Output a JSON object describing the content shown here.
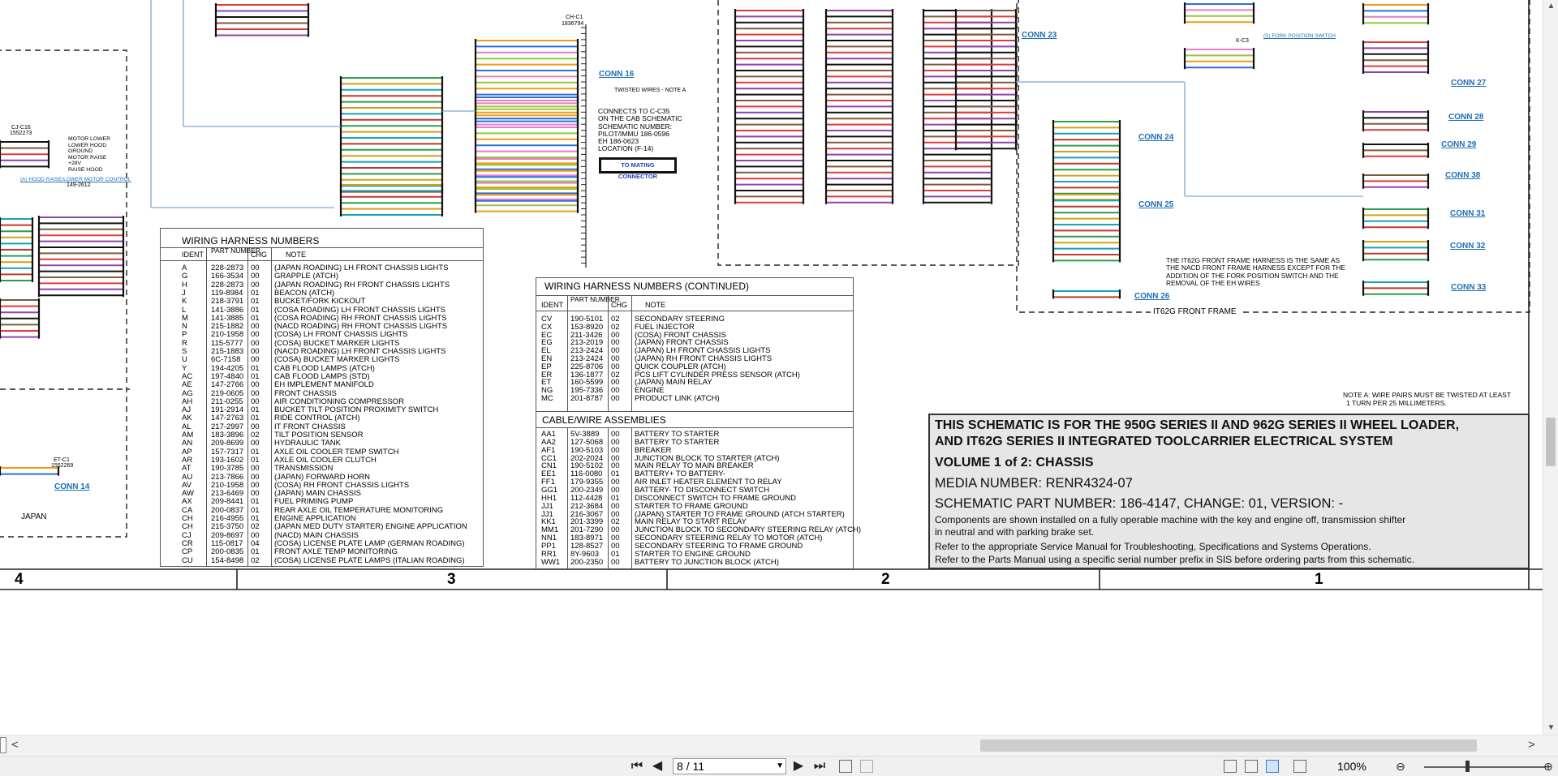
{
  "schematic": {
    "connectors": {
      "conn16": "CONN 16",
      "conn23": "CONN 23",
      "conn24": "CONN 24",
      "conn25": "CONN 25",
      "conn26": "CONN 26",
      "conn27": "CONN 27",
      "conn28": "CONN 28",
      "conn29": "CONN 29",
      "conn38": "CONN 38",
      "conn31": "CONN 31",
      "conn32": "CONN 32",
      "conn33": "CONN 33",
      "conn14": "CONN 14"
    },
    "ch_c1": "CH-C1",
    "ch_c1_part": "1836794",
    "twisted_note": "TWISTED WIRES - NOTE A",
    "connects_note": [
      "CONNECTS TO C-C35",
      "ON THE CAB SCHEMATIC",
      "SCHEMATIC NUMBER:",
      "PILOT/IMMU 186-0596",
      "EH      186-0623",
      "LOCATION (F-14)"
    ],
    "mating_button": "TO MATING CONNECTOR",
    "hood_link": "(A) HOOD RAISE/LOWER MOTOR CONTROL",
    "hood_part": "149-2612",
    "japan_label": "JAPAN",
    "fork_switch": "(S) FORK POSITION SWITCH",
    "kc3": "K-C3",
    "frame_label": "IT62G FRONT FRAME",
    "frame_note": [
      "THE IT62G FRONT FRAME HARNESS IS THE SAME AS",
      "THE NACD FRONT FRAME HARNESS EXCEPT FOR THE",
      "ADDITION OF THE FORK POSITION SWITCH AND THE",
      "REMOVAL OF THE EH WIRES"
    ],
    "note_a": [
      "NOTE A: WIRE PAIRS MUST BE TWISTED AT LEAST",
      "1 TURN PER 25 MILLIMETERS."
    ],
    "motor_labels": [
      "MOTOR LOWER",
      "LOWER HOOD",
      "GROUND",
      "MOTOR RAISE",
      "+28V",
      "RAISE HOOD"
    ],
    "cjc16": "CJ-C16",
    "cjc16_part": "1552273",
    "etc1": "ET-C1",
    "etc1_part": "1552269",
    "zones": [
      "4",
      "3",
      "2",
      "1"
    ]
  },
  "harness_table": {
    "title": "WIRING HARNESS NUMBERS",
    "headers": {
      "ident": "IDENT",
      "part": "PART NUMBER",
      "chg": "CHG",
      "note": "NOTE"
    },
    "rows": [
      [
        "A",
        "228-2873",
        "00",
        "(JAPAN ROADING) LH FRONT CHASSIS LIGHTS"
      ],
      [
        "G",
        "166-3534",
        "00",
        "GRAPPLE (ATCH)"
      ],
      [
        "H",
        "228-2873",
        "00",
        "(JAPAN ROADING) RH FRONT CHASSIS LIGHTS"
      ],
      [
        "J",
        "119-8984",
        "01",
        "BEACON (ATCH)"
      ],
      [
        "K",
        "218-3791",
        "01",
        "BUCKET/FORK KICKOUT"
      ],
      [
        "L",
        "141-3886",
        "01",
        "(COSA ROADING) LH FRONT CHASSIS LIGHTS"
      ],
      [
        "M",
        "141-3885",
        "01",
        "(COSA ROADING) RH FRONT CHASSIS LIGHTS"
      ],
      [
        "N",
        "215-1882",
        "00",
        "(NACD ROADING) RH FRONT CHASSIS LIGHTS"
      ],
      [
        "P",
        "210-1958",
        "00",
        "(COSA) LH FRONT CHASSIS LIGHTS"
      ],
      [
        "R",
        "115-5777",
        "00",
        "(COSA) BUCKET MARKER LIGHTS"
      ],
      [
        "S",
        "215-1883",
        "00",
        "(NACD ROADING) LH FRONT CHASSIS LIGHTS"
      ],
      [
        "U",
        "6C-7158",
        "00",
        "(COSA) BUCKET MARKER LIGHTS"
      ],
      [
        "Y",
        "194-4205",
        "01",
        "CAB FLOOD LAMPS (ATCH)"
      ],
      [
        "AC",
        "197-4840",
        "01",
        "CAB FLOOD LAMPS (STD)"
      ],
      [
        "AE",
        "147-2766",
        "00",
        "EH IMPLEMENT MANIFOLD"
      ],
      [
        "AG",
        "219-0605",
        "00",
        "FRONT CHASSIS"
      ],
      [
        "AH",
        "211-0255",
        "00",
        "AIR CONDITIONING COMPRESSOR"
      ],
      [
        "AJ",
        "191-2914",
        "01",
        "BUCKET TILT POSITION PROXIMITY SWITCH"
      ],
      [
        "AK",
        "147-2763",
        "01",
        "RIDE CONTROL (ATCH)"
      ],
      [
        "AL",
        "217-2997",
        "00",
        "IT FRONT CHASSIS"
      ],
      [
        "AM",
        "183-3896",
        "02",
        "TILT POSITION SENSOR"
      ],
      [
        "AN",
        "209-8699",
        "00",
        "HYDRAULIC TANK"
      ],
      [
        "AP",
        "157-7317",
        "01",
        "AXLE OIL COOLER TEMP SWITCH"
      ],
      [
        "AR",
        "193-1602",
        "01",
        "AXLE OIL COOLER CLUTCH"
      ],
      [
        "AT",
        "190-3785",
        "00",
        "TRANSMISSION"
      ],
      [
        "AU",
        "213-7866",
        "00",
        "(JAPAN) FORWARD HORN"
      ],
      [
        "AV",
        "210-1958",
        "00",
        "(COSA) RH FRONT CHASSIS LIGHTS"
      ],
      [
        "AW",
        "213-6469",
        "00",
        "(JAPAN) MAIN CHASSIS"
      ],
      [
        "AX",
        "209-8441",
        "01",
        "FUEL PRIMING PUMP"
      ],
      [
        "CA",
        "200-0837",
        "01",
        "REAR AXLE OIL TEMPERATURE MONITORING"
      ],
      [
        "CH",
        "216-4955",
        "01",
        "ENGINE APPLICATION"
      ],
      [
        "CH",
        "215-3750",
        "02",
        "(JAPAN MED DUTY STARTER) ENGINE APPLICATION"
      ],
      [
        "CJ",
        "209-8697",
        "00",
        "(NACD) MAIN CHASSIS"
      ],
      [
        "CR",
        "115-0817",
        "04",
        "(COSA) LICENSE PLATE LAMP (GERMAN ROADING)"
      ],
      [
        "CP",
        "200-0835",
        "01",
        "FRONT AXLE TEMP MONITORING"
      ],
      [
        "CU",
        "154-8498",
        "02",
        "(COSA) LICENSE PLATE LAMPS (ITALIAN ROADING)"
      ]
    ]
  },
  "harness_table2": {
    "title": "WIRING HARNESS NUMBERS (CONTINUED)",
    "headers": {
      "ident": "IDENT",
      "part": "PART NUMBER",
      "chg": "CHG",
      "note": "NOTE"
    },
    "rows": [
      [
        "CV",
        "190-5101",
        "02",
        "SECONDARY STEERING"
      ],
      [
        "CX",
        "153-8920",
        "02",
        "FUEL INJECTOR"
      ],
      [
        "EC",
        "211-3426",
        "00",
        "(COSA) FRONT CHASSIS"
      ],
      [
        "EG",
        "213-2019",
        "00",
        "(JAPAN) FRONT CHASSIS"
      ],
      [
        "EL",
        "213-2424",
        "00",
        "(JAPAN) LH FRONT CHASSIS LIGHTS"
      ],
      [
        "EN",
        "213-2424",
        "00",
        "(JAPAN) RH FRONT CHASSIS LIGHTS"
      ],
      [
        "EP",
        "225-8706",
        "00",
        "QUICK COUPLER (ATCH)"
      ],
      [
        "ER",
        "136-1877",
        "02",
        "PCS LIFT CYLINDER PRESS SENSOR (ATCH)"
      ],
      [
        "ET",
        "160-5599",
        "00",
        "(JAPAN) MAIN RELAY"
      ],
      [
        "NG",
        "195-7336",
        "00",
        "ENGINE"
      ],
      [
        "MC",
        "201-8787",
        "00",
        "PRODUCT LINK (ATCH)"
      ]
    ]
  },
  "cable_table": {
    "title": "CABLE/WIRE ASSEMBLIES",
    "rows": [
      [
        "AA1",
        "5V-3889",
        "00",
        "BATTERY TO STARTER"
      ],
      [
        "AA2",
        "127-5068",
        "00",
        "BATTERY TO STARTER"
      ],
      [
        "AF1",
        "190-5103",
        "00",
        "BREAKER"
      ],
      [
        "CC1",
        "202-2024",
        "00",
        "JUNCTION BLOCK TO STARTER (ATCH)"
      ],
      [
        "CN1",
        "190-5102",
        "00",
        "MAIN RELAY TO MAIN BREAKER"
      ],
      [
        "EE1",
        "116-0080",
        "01",
        "BATTERY+ TO BATTERY-"
      ],
      [
        "FF1",
        "179-9355",
        "00",
        "AIR INLET HEATER ELEMENT TO RELAY"
      ],
      [
        "GG1",
        "200-2349",
        "00",
        "BATTERY- TO DISCONNECT SWITCH"
      ],
      [
        "HH1",
        "112-4428",
        "01",
        "DISCONNECT SWITCH TO FRAME GROUND"
      ],
      [
        "JJ1",
        "212-3684",
        "00",
        "STARTER TO FRAME GROUND"
      ],
      [
        "JJ1",
        "216-3067",
        "00",
        "(JAPAN) STARTER TO FRAME GROUND (ATCH STARTER)"
      ],
      [
        "KK1",
        "201-3399",
        "02",
        "MAIN RELAY TO START RELAY"
      ],
      [
        "MM1",
        "201-7290",
        "00",
        "JUNCTION BLOCK TO SECONDARY STEERING RELAY (ATCH)"
      ],
      [
        "NN1",
        "183-8971",
        "00",
        "SECONDARY STEERING RELAY TO MOTOR (ATCH)"
      ],
      [
        "PP1",
        "128-8527",
        "00",
        "SECONDARY STEERING TO FRAME GROUND"
      ],
      [
        "RR1",
        "8Y-9603",
        "01",
        "STARTER TO ENGINE GROUND"
      ],
      [
        "WW1",
        "200-2350",
        "00",
        "BATTERY TO JUNCTION BLOCK (ATCH)"
      ]
    ]
  },
  "title_block": {
    "line1": "THIS SCHEMATIC IS FOR THE 950G SERIES II AND 962G SERIES II WHEEL LOADER,",
    "line2": "AND IT62G SERIES II INTEGRATED TOOLCARRIER ELECTRICAL SYSTEM",
    "line3": "VOLUME 1 of 2: CHASSIS",
    "media": "MEDIA NUMBER: RENR4324-07",
    "part": "SCHEMATIC PART NUMBER: 186-4147, CHANGE: 01, VERSION: -",
    "desc1": "Components are shown installed on a fully operable machine with the key and engine off, transmission shifter",
    "desc2": "in neutral and with parking brake set.",
    "ref1": "Refer to the appropriate Service Manual for Troubleshooting, Specifications and Systems Operations.",
    "ref2": "Refer to the Parts Manual using a specific serial number prefix in SIS before ordering parts from this schematic."
  },
  "toolbar": {
    "page_value": "8 / 11",
    "zoom": "100%",
    "first_icon": "first-page-icon",
    "prev_icon": "prev-page-icon",
    "next_icon": "next-page-icon",
    "last_icon": "last-page-icon",
    "dropdown_icon": "chevron-down-icon"
  },
  "colors": {
    "accent": "#1f6fb5",
    "panel": "#e6e6e6",
    "toolbar_bg": "#f0f0f0"
  }
}
